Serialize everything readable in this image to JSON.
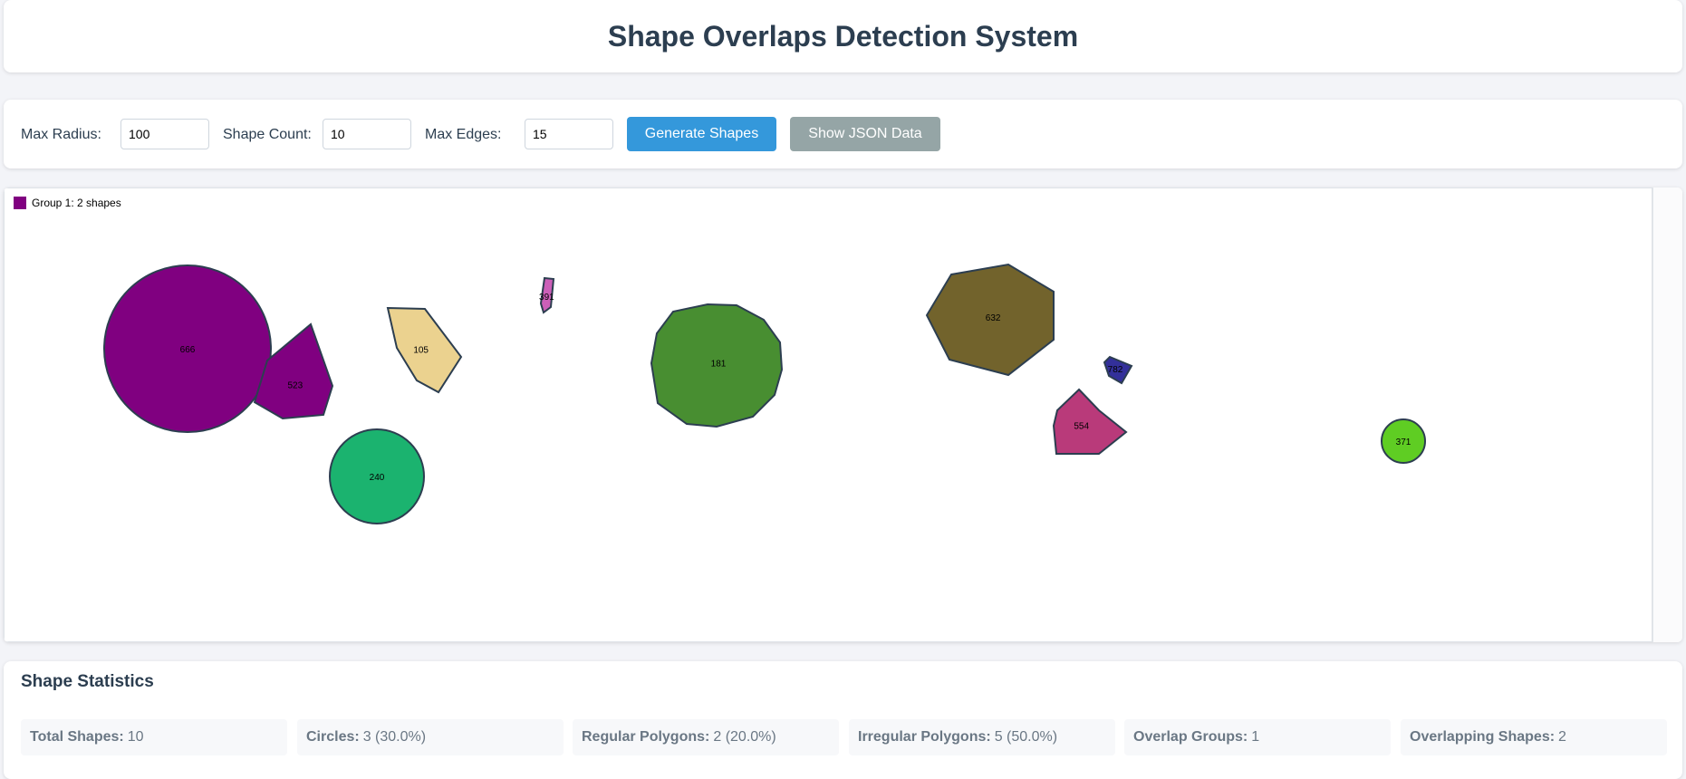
{
  "header": {
    "title": "Shape Overlaps Detection System"
  },
  "controls": {
    "max_radius_label": "Max Radius:",
    "max_radius_value": "100",
    "shape_count_label": "Shape Count:",
    "shape_count_value": "10",
    "max_edges_label": "Max Edges:",
    "max_edges_value": "15",
    "generate_label": "Generate Shapes",
    "json_label": "Show JSON Data",
    "generate_color": "#3498db",
    "json_color": "#95a5a6"
  },
  "legend": {
    "text": "Group 1: 2 shapes",
    "color": "#800080"
  },
  "shapes": [
    {
      "id": "666",
      "kind": "circle",
      "color": "#800080"
    },
    {
      "id": "523",
      "kind": "polygon",
      "color": "#800080"
    },
    {
      "id": "105",
      "kind": "polygon",
      "color": "#ebd28f"
    },
    {
      "id": "391",
      "kind": "polygon",
      "color": "#cc5fb8"
    },
    {
      "id": "240",
      "kind": "circle",
      "color": "#1bb36f"
    },
    {
      "id": "181",
      "kind": "polygon",
      "color": "#488e31"
    },
    {
      "id": "632",
      "kind": "polygon",
      "color": "#72632c"
    },
    {
      "id": "782",
      "kind": "polygon",
      "color": "#33309a"
    },
    {
      "id": "554",
      "kind": "polygon",
      "color": "#b93a7a"
    },
    {
      "id": "371",
      "kind": "circle",
      "color": "#5fcd23"
    }
  ],
  "stats": {
    "title": "Shape Statistics",
    "items": [
      {
        "label": "Total Shapes:",
        "value": "10"
      },
      {
        "label": "Circles:",
        "value": "3 (30.0%)"
      },
      {
        "label": "Regular Polygons:",
        "value": "2 (20.0%)"
      },
      {
        "label": "Irregular Polygons:",
        "value": "5 (50.0%)"
      },
      {
        "label": "Overlap Groups:",
        "value": "1"
      },
      {
        "label": "Overlapping Shapes:",
        "value": "2"
      }
    ]
  }
}
